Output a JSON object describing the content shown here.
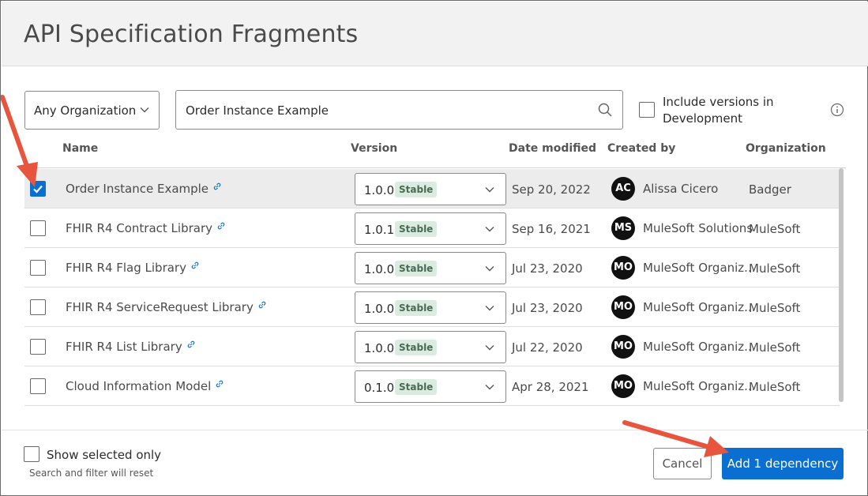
{
  "dialog": {
    "title": "API Specification Fragments"
  },
  "filters": {
    "organization_selected": "Any Organization",
    "search_value": "Order Instance Example",
    "include_dev_label": "Include versions in Development",
    "include_dev_checked": false
  },
  "table": {
    "headers": {
      "name": "Name",
      "version": "Version",
      "date_modified": "Date modified",
      "created_by": "Created by",
      "organization": "Organization"
    },
    "rows": [
      {
        "checked": true,
        "name": "Order Instance Example",
        "version": "1.0.0",
        "status": "Stable",
        "date": "Sep 20, 2022",
        "initials": "AC",
        "creator": "Alissa Cicero",
        "org": "Badger"
      },
      {
        "checked": false,
        "name": "FHIR R4 Contract Library",
        "version": "1.0.1",
        "status": "Stable",
        "date": "Sep 16, 2021",
        "initials": "MS",
        "creator": "MuleSoft Solutions",
        "org": "MuleSoft"
      },
      {
        "checked": false,
        "name": "FHIR R4 Flag Library",
        "version": "1.0.0",
        "status": "Stable",
        "date": "Jul 23, 2020",
        "initials": "MO",
        "creator": "MuleSoft Organiz...",
        "org": "MuleSoft"
      },
      {
        "checked": false,
        "name": "FHIR R4 ServiceRequest Library",
        "version": "1.0.0",
        "status": "Stable",
        "date": "Jul 23, 2020",
        "initials": "MO",
        "creator": "MuleSoft Organiz...",
        "org": "MuleSoft"
      },
      {
        "checked": false,
        "name": "FHIR R4 List Library",
        "version": "1.0.0",
        "status": "Stable",
        "date": "Jul 22, 2020",
        "initials": "MO",
        "creator": "MuleSoft Organiz...",
        "org": "MuleSoft"
      },
      {
        "checked": false,
        "name": "Cloud Information Model",
        "version": "0.1.0",
        "status": "Stable",
        "date": "Apr 28, 2021",
        "initials": "MO",
        "creator": "MuleSoft Organiz...",
        "org": "MuleSoft"
      }
    ]
  },
  "footer": {
    "show_selected_label": "Show selected only",
    "show_selected_checked": false,
    "reset_note": "Search and filter will reset",
    "cancel_label": "Cancel",
    "add_label": "Add 1 dependency"
  },
  "colors": {
    "primary": "#0a6fd1",
    "annotation_arrow": "#e8553e",
    "stable_badge_bg": "#d9ecdf"
  }
}
